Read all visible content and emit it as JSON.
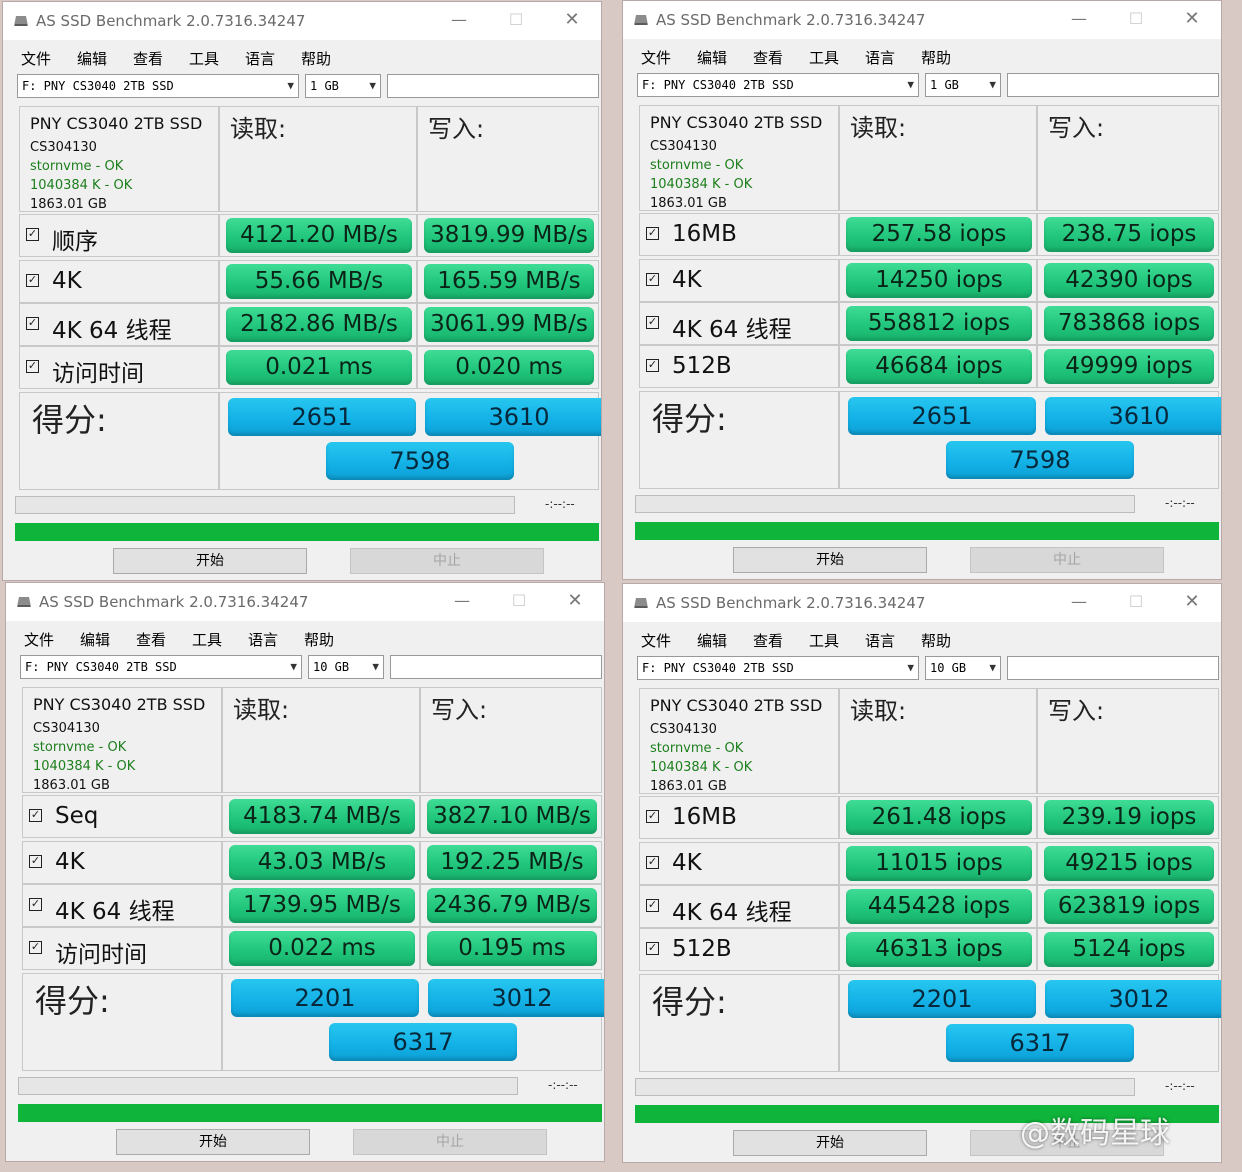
{
  "app_title": "AS SSD Benchmark 2.0.7316.34247",
  "menu": [
    "文件",
    "编辑",
    "查看",
    "工具",
    "语言",
    "帮助"
  ],
  "window_controls": {
    "minimize": "—",
    "maximize": "☐",
    "close": "✕"
  },
  "drive": {
    "selected": "F:  PNY CS3040 2TB SSD",
    "name": "PNY CS3040 2TB SSD",
    "firmware": "CS304130",
    "driver": "stornvme - OK",
    "alignment": "1040384 K - OK",
    "capacity": "1863.01 GB"
  },
  "headers": {
    "read": "读取:",
    "write": "写入:",
    "score": "得分:"
  },
  "time_label": "-:--:--",
  "buttons": {
    "start": "开始",
    "stop": "中止"
  },
  "watermark": "@数码星球",
  "windows": [
    {
      "size": "1 GB",
      "rows": [
        {
          "label": "顺序",
          "read": "4121.20 MB/s",
          "write": "3819.99 MB/s"
        },
        {
          "label": "4K",
          "read": "55.66 MB/s",
          "write": "165.59 MB/s"
        },
        {
          "label": "4K 64 线程",
          "read": "2182.86 MB/s",
          "write": "3061.99 MB/s"
        },
        {
          "label": "访问时间",
          "read": "0.021 ms",
          "write": "0.020 ms"
        }
      ],
      "score": {
        "read": "2651",
        "write": "3610",
        "total": "7598"
      }
    },
    {
      "size": "1 GB",
      "rows": [
        {
          "label": "16MB",
          "read": "257.58 iops",
          "write": "238.75 iops"
        },
        {
          "label": "4K",
          "read": "14250 iops",
          "write": "42390 iops"
        },
        {
          "label": "4K 64 线程",
          "read": "558812 iops",
          "write": "783868 iops"
        },
        {
          "label": "512B",
          "read": "46684 iops",
          "write": "49999 iops"
        }
      ],
      "score": {
        "read": "2651",
        "write": "3610",
        "total": "7598"
      }
    },
    {
      "size": "10 GB",
      "rows": [
        {
          "label": "Seq",
          "read": "4183.74 MB/s",
          "write": "3827.10 MB/s"
        },
        {
          "label": "4K",
          "read": "43.03 MB/s",
          "write": "192.25 MB/s"
        },
        {
          "label": "4K 64 线程",
          "read": "1739.95 MB/s",
          "write": "2436.79 MB/s"
        },
        {
          "label": "访问时间",
          "read": "0.022 ms",
          "write": "0.195 ms"
        }
      ],
      "score": {
        "read": "2201",
        "write": "3012",
        "total": "6317"
      }
    },
    {
      "size": "10 GB",
      "rows": [
        {
          "label": "16MB",
          "read": "261.48 iops",
          "write": "239.19 iops"
        },
        {
          "label": "4K",
          "read": "11015 iops",
          "write": "49215 iops"
        },
        {
          "label": "4K 64 线程",
          "read": "445428 iops",
          "write": "623819 iops"
        },
        {
          "label": "512B",
          "read": "46313 iops",
          "write": "5124 iops"
        }
      ],
      "score": {
        "read": "2201",
        "write": "3012",
        "total": "6317"
      }
    }
  ]
}
